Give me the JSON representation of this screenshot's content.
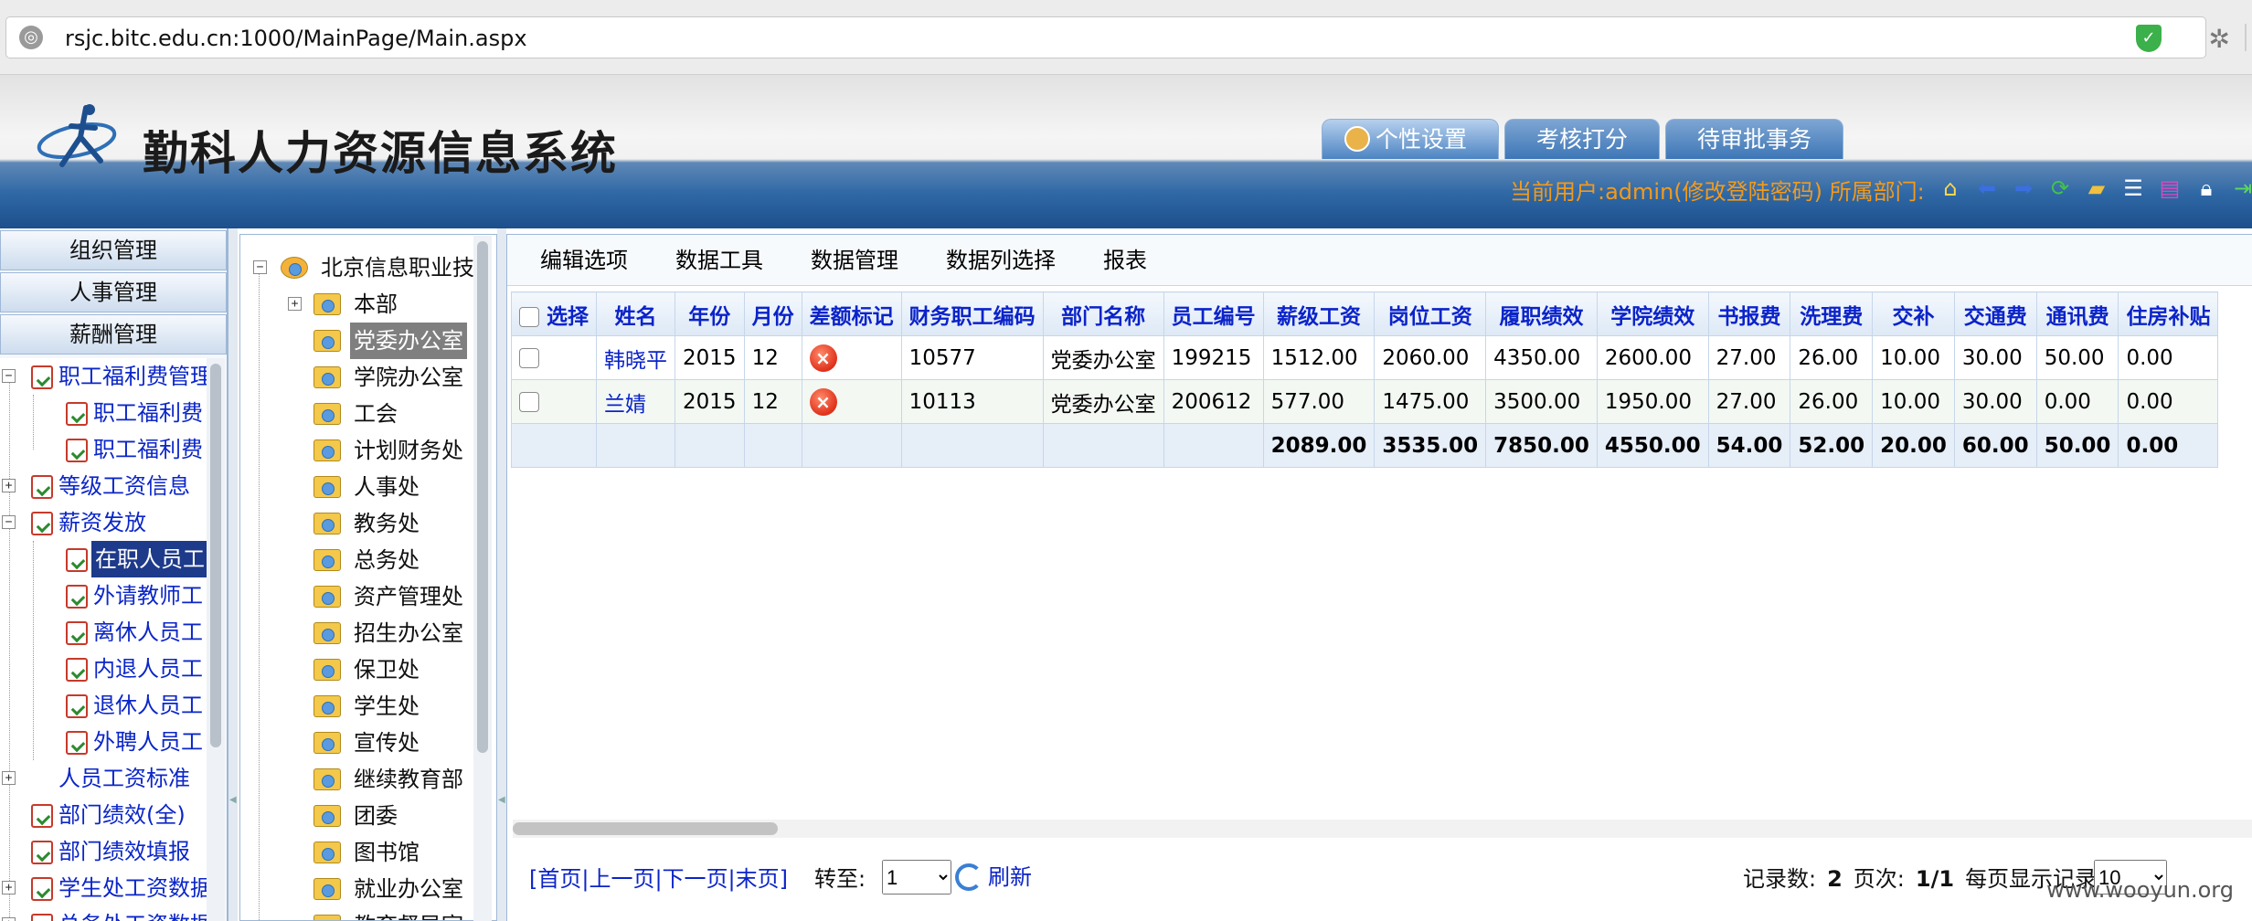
{
  "browser": {
    "url": "rsjc.bitc.edu.cn:1000/MainPage/Main.aspx"
  },
  "header": {
    "title": "勤科人力资源信息系统",
    "tabs": [
      "个性设置",
      "考核打分",
      "待审批事务"
    ],
    "user_prefix": "当前用户:admin(",
    "change_password": "修改登陆密码",
    "dept_label": ") 所属部门:"
  },
  "left_modules": [
    "组织管理",
    "人事管理",
    "薪酬管理"
  ],
  "menu_tree": [
    {
      "label": "职工福利费管理",
      "toggle": "-"
    },
    {
      "label": "职工福利费"
    },
    {
      "label": "职工福利费"
    },
    {
      "label": "等级工资信息",
      "toggle": "+"
    },
    {
      "label": "薪资发放",
      "toggle": "-"
    },
    {
      "label": "在职人员工",
      "selected": true
    },
    {
      "label": "外请教师工"
    },
    {
      "label": "离休人员工"
    },
    {
      "label": "内退人员工"
    },
    {
      "label": "退休人员工"
    },
    {
      "label": "外聘人员工"
    },
    {
      "label": "人员工资标准",
      "toggle": "+"
    },
    {
      "label": "部门绩效(全)"
    },
    {
      "label": "部门绩效填报"
    },
    {
      "label": "学生处工资数据",
      "toggle": "+"
    },
    {
      "label": "总务处工资数据",
      "toggle": "+"
    }
  ],
  "dept_tree": {
    "root": "北京信息职业技",
    "items": [
      "本部",
      "党委办公室",
      "学院办公室",
      "工会",
      "计划财务处",
      "人事处",
      "教务处",
      "总务处",
      "资产管理处",
      "招生办公室",
      "保卫处",
      "学生处",
      "宣传处",
      "继续教育部",
      "团委",
      "图书馆",
      "就业办公室",
      "教育督导室"
    ],
    "selected": "党委办公室"
  },
  "grid_menu": [
    "编辑选项",
    "数据工具",
    "数据管理",
    "数据列选择",
    "报表"
  ],
  "grid": {
    "columns": [
      "选择",
      "姓名",
      "年份",
      "月份",
      "差额标记",
      "财务职工编码",
      "部门名称",
      "员工编号",
      "薪级工资",
      "岗位工资",
      "履职绩效",
      "学院绩效",
      "书报费",
      "洗理费",
      "交补",
      "交通费",
      "通讯费",
      "住房补贴"
    ],
    "rows": [
      {
        "name": "韩晓平",
        "year": "2015",
        "month": "12",
        "finance_code": "10577",
        "dept": "党委办公室",
        "emp_no": "199215",
        "salary_grade": "1512.00",
        "post": "2060.00",
        "perf": "4350.00",
        "college_perf": "2600.00",
        "books": "27.00",
        "wash": "26.00",
        "traffic_sub": "10.00",
        "traffic": "30.00",
        "phone": "50.00",
        "housing": "0.00"
      },
      {
        "name": "兰婧",
        "year": "2015",
        "month": "12",
        "finance_code": "10113",
        "dept": "党委办公室",
        "emp_no": "200612",
        "salary_grade": "577.00",
        "post": "1475.00",
        "perf": "3500.00",
        "college_perf": "1950.00",
        "books": "27.00",
        "wash": "26.00",
        "traffic_sub": "10.00",
        "traffic": "30.00",
        "phone": "0.00",
        "housing": "0.00"
      }
    ],
    "totals": {
      "salary_grade": "2089.00",
      "post": "3535.00",
      "perf": "7850.00",
      "college_perf": "4550.00",
      "books": "54.00",
      "wash": "52.00",
      "traffic_sub": "20.00",
      "traffic": "60.00",
      "phone": "50.00",
      "housing": "0.00"
    }
  },
  "pager": {
    "first": "[首页|",
    "prev": "上一页|",
    "next": "下一页|",
    "last": "末页]",
    "goto_label": "转至:",
    "goto_value": "1",
    "refresh": "刷新",
    "records_label": "记录数:",
    "records": "2",
    "page_label": "页次:",
    "page": "1/1",
    "pagesize_label": "每页显示记录数:",
    "pagesize": "10"
  },
  "watermark": "www.wooyun.org"
}
